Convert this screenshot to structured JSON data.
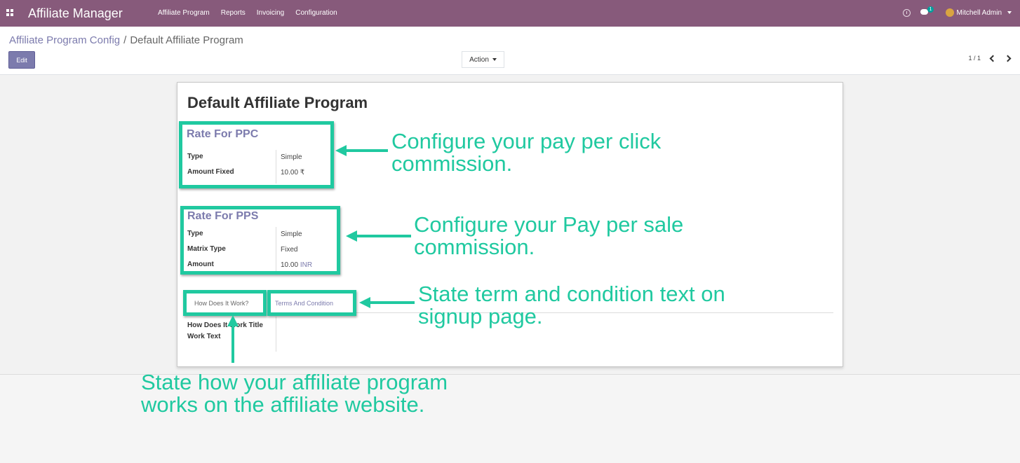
{
  "navbar": {
    "app_title": "Affiliate Manager",
    "menu": [
      "Affiliate Program",
      "Reports",
      "Invoicing",
      "Configuration"
    ],
    "chat_badge": "1",
    "user_name": "Mitchell Admin",
    "bg_color": "#875a7b"
  },
  "control": {
    "breadcrumb_parent": "Affiliate Program Config",
    "breadcrumb_separator": "/",
    "breadcrumb_current": "Default Affiliate Program",
    "edit_label": "Edit",
    "action_label": "Action",
    "pager": "1 / 1"
  },
  "form": {
    "title": "Default Affiliate Program",
    "ppc": {
      "title": "Rate For PPC",
      "type_label": "Type",
      "type_value": "Simple",
      "amount_label": "Amount Fixed",
      "amount_value": "10.00 ₹"
    },
    "pps": {
      "title": "Rate For PPS",
      "type_label": "Type",
      "type_value": "Simple",
      "matrix_label": "Matrix Type",
      "matrix_value": "Fixed",
      "amount_label": "Amount",
      "amount_value": "10.00",
      "currency": "INR"
    },
    "tabs": [
      "How Does It Work?",
      "Terms And Condition"
    ],
    "work_title_label": "How Does It Work Title",
    "work_text_label": "Work Text"
  },
  "annotations": {
    "ppc": "Configure your pay per click\ncommission.",
    "pps": "Configure your Pay per sale\ncommission.",
    "terms": "State term and condition text on\nsignup page.",
    "how": "State how your affiliate program\nworks on the affiliate website.",
    "accent_color": "#20c9a0"
  }
}
